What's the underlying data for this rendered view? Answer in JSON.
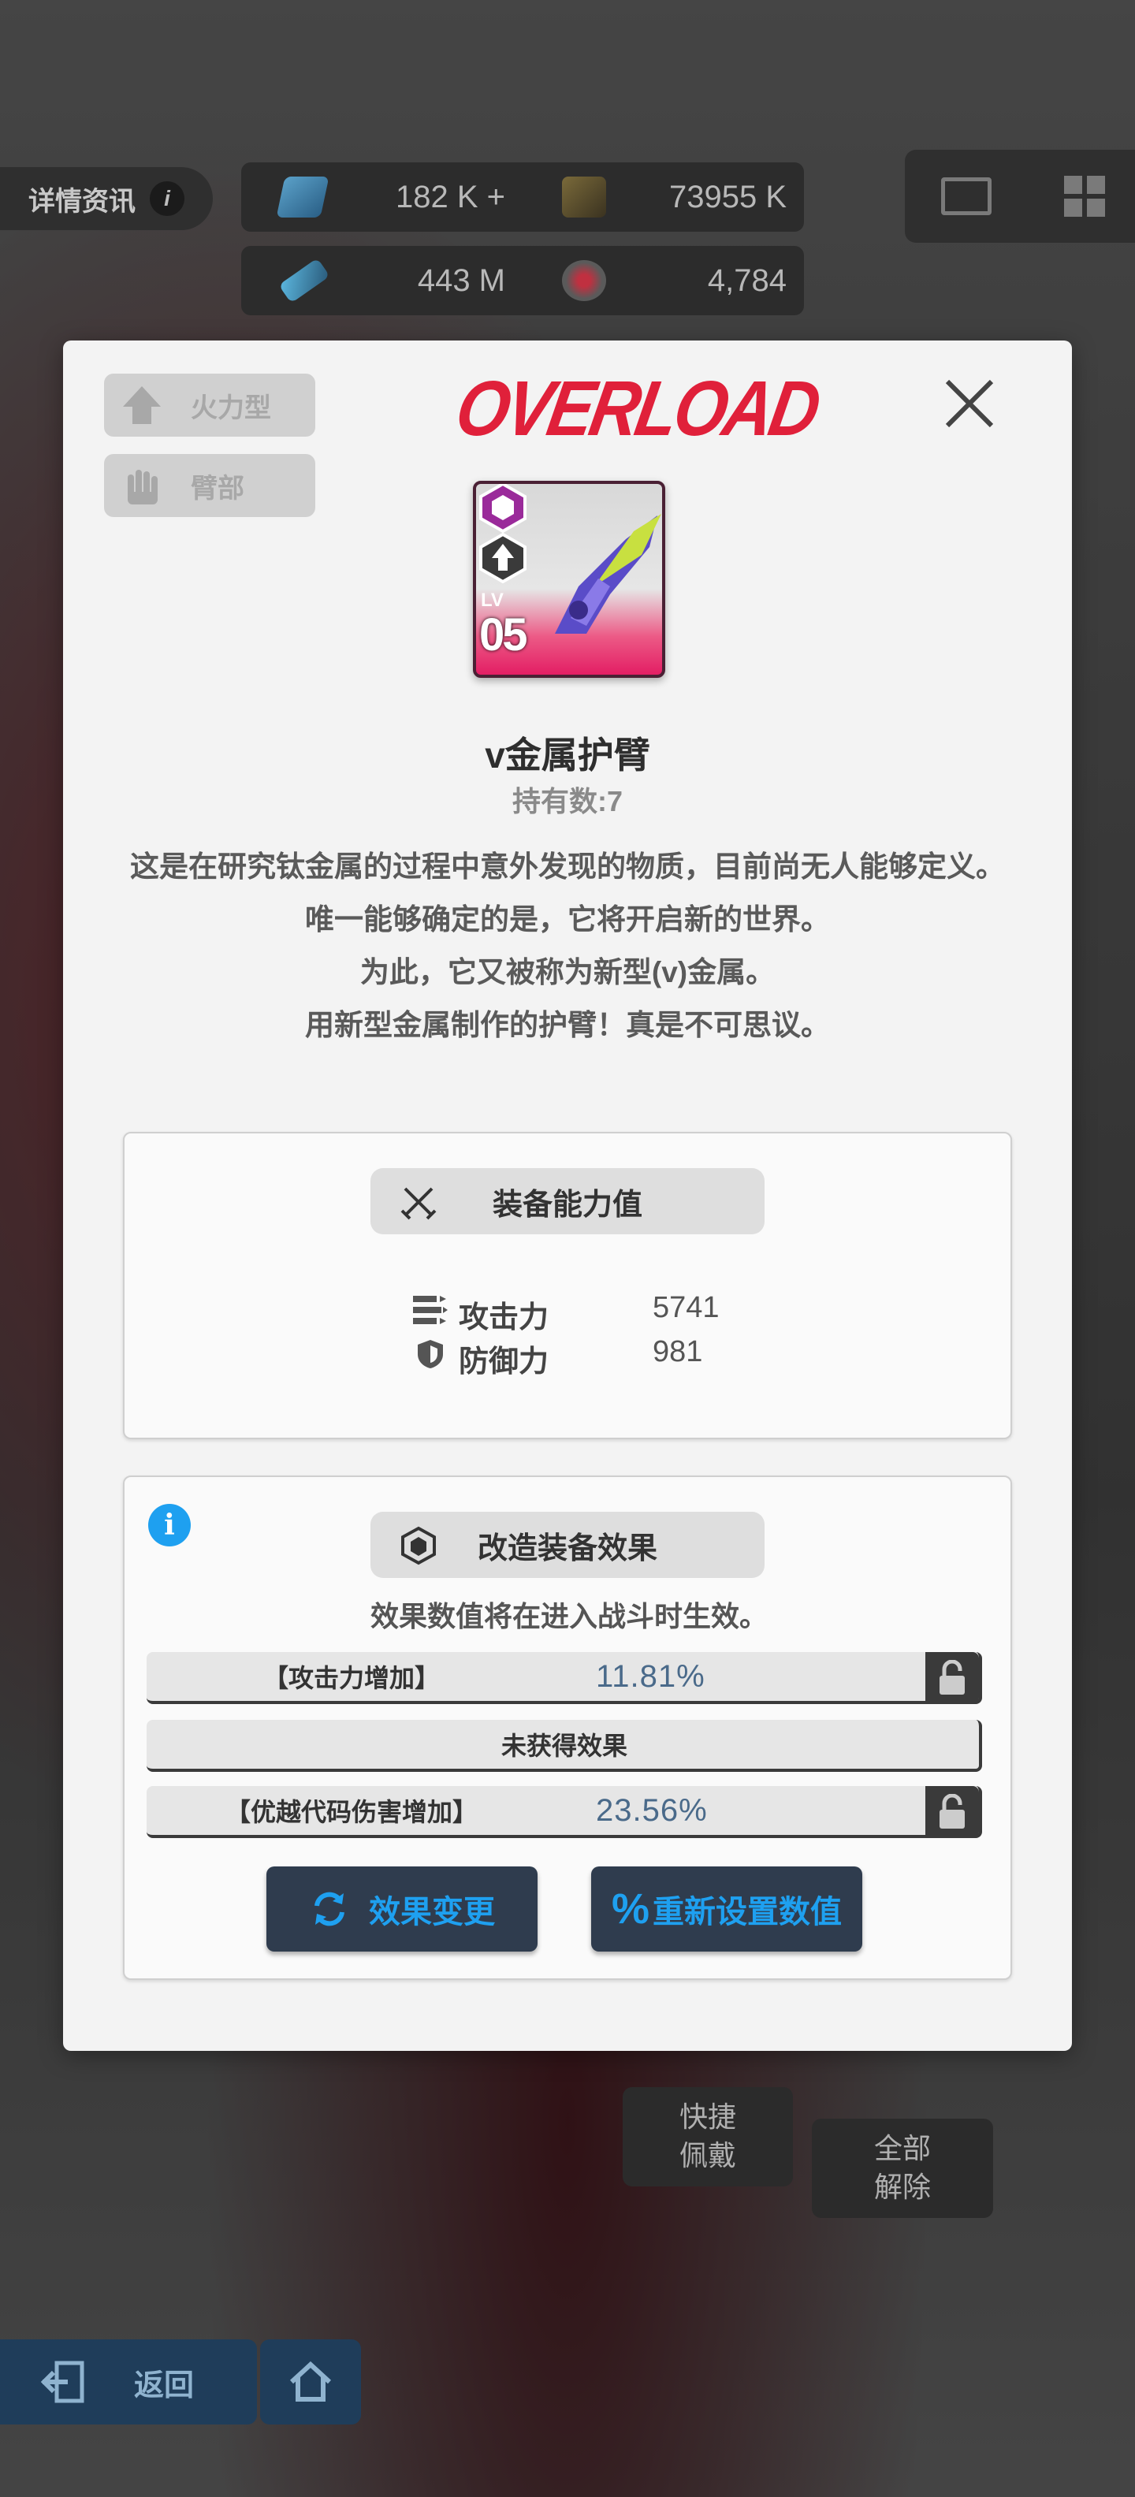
{
  "hud": {
    "detail_label": "详情资讯",
    "info_glyph": "i",
    "resources_row1": [
      {
        "icon": "crystal-icon",
        "value": "182 K +"
      },
      {
        "icon": "credit-card-icon",
        "value": "73955 K"
      }
    ],
    "resources_row2": [
      {
        "icon": "core-dust-icon",
        "value": "443 M"
      },
      {
        "icon": "body-label-icon",
        "value": "4,784"
      }
    ]
  },
  "bottom": {
    "back_label": "返回",
    "quick_equip": "快捷\n佩戴",
    "release_all": "全部\n解除"
  },
  "modal": {
    "class_chip": "火力型",
    "slot_chip": "臂部",
    "brand": "OVERLOAD",
    "card": {
      "lv_label": "LV",
      "lv_value": "05"
    },
    "item_name": "v金属护臂",
    "owned": "持有数:7",
    "description": [
      "这是在研究钛金属的过程中意外发现的物质，目前尚无人能够定义。",
      "唯一能够确定的是，它将开启新的世界。",
      "为此，它又被称为新型(v)金属。",
      "用新型金属制作的护臂！真是不可思议。"
    ],
    "stats_panel": {
      "title": "装备能力值",
      "attack_label": "攻击力",
      "attack_value": "5741",
      "defense_label": "防御力",
      "defense_value": "981"
    },
    "effects_panel": {
      "info_glyph": "i",
      "title": "改造装备效果",
      "note": "效果数值将在进入战斗时生效。",
      "effect1_label": "【攻击力增加】",
      "effect1_value": "11.81%",
      "effect2_label": "未获得效果",
      "effect3_label": "【优越代码伤害增加】",
      "effect3_value": "23.56%",
      "change_button": "效果变更",
      "reset_button": "重新设置数值",
      "reset_glyph": "%"
    }
  },
  "colors": {
    "brand_red": "#e0203a",
    "accent_blue": "#1ea0f0",
    "card_pink": "#e31e64",
    "button_dark": "#2f3c4e"
  }
}
